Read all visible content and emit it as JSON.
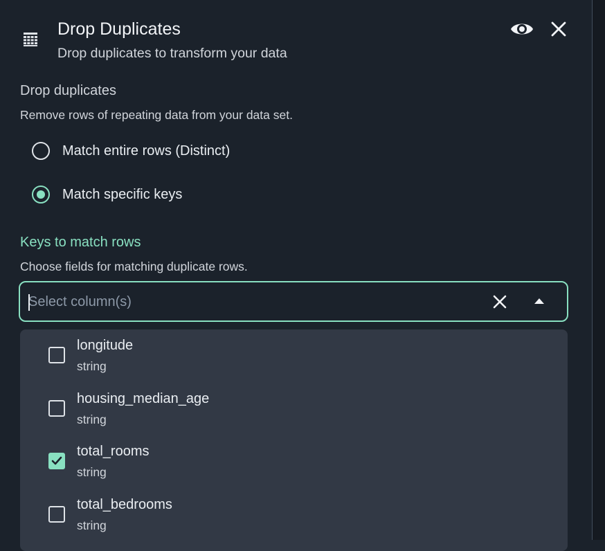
{
  "header": {
    "icon": "grid-table-icon",
    "title": "Drop Duplicates",
    "subtitle": "Drop duplicates to transform your data",
    "preview_icon": "eye-icon",
    "close_icon": "close-icon"
  },
  "drop_section": {
    "label": "Drop duplicates",
    "description": "Remove rows of repeating data from your data set.",
    "options": [
      {
        "label": "Match entire rows (Distinct)",
        "selected": false
      },
      {
        "label": "Match specific keys",
        "selected": true
      }
    ]
  },
  "keys_section": {
    "label": "Keys to match rows",
    "description": "Choose fields for matching duplicate rows.",
    "select": {
      "placeholder": "Select column(s)",
      "value": "",
      "clear_icon": "clear-icon",
      "toggle_icon": "caret-up-icon"
    }
  },
  "columns": [
    {
      "name": "longitude",
      "type": "string",
      "checked": false
    },
    {
      "name": "housing_median_age",
      "type": "string",
      "checked": false
    },
    {
      "name": "total_rooms",
      "type": "string",
      "checked": true
    },
    {
      "name": "total_bedrooms",
      "type": "string",
      "checked": false
    }
  ],
  "colors": {
    "background": "#1b222b",
    "accent": "#89e0c1",
    "dropdown_bg": "#323945",
    "text": "#eaeef2"
  }
}
